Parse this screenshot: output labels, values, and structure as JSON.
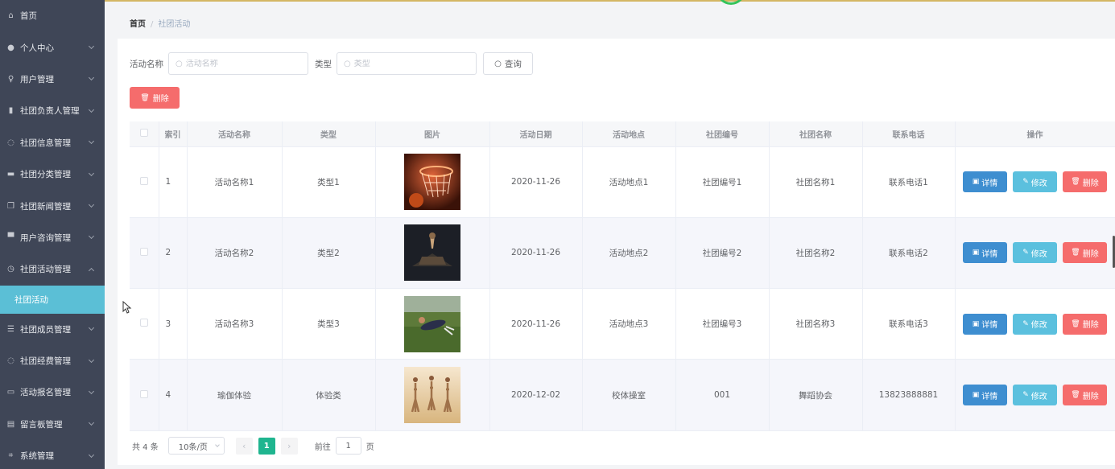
{
  "sidebar": {
    "items": [
      {
        "label": "首页",
        "icon": "home-icon",
        "chevron": false
      },
      {
        "label": "个人中心",
        "icon": "user-icon",
        "chevron": true
      },
      {
        "label": "用户管理",
        "icon": "microphone-icon",
        "chevron": true
      },
      {
        "label": "社团负责人管理",
        "icon": "bar-chart-icon",
        "chevron": true
      },
      {
        "label": "社团信息管理",
        "icon": "globe-icon",
        "chevron": true
      },
      {
        "label": "社团分类管理",
        "icon": "monitor-icon",
        "chevron": true
      },
      {
        "label": "社团新闻管理",
        "icon": "copy-icon",
        "chevron": true
      },
      {
        "label": "用户咨询管理",
        "icon": "message-icon",
        "chevron": true
      },
      {
        "label": "社团活动管理",
        "icon": "clock-icon",
        "chevron": true,
        "expanded": true
      }
    ],
    "active_sub": "社团活动",
    "items_after": [
      {
        "label": "社团成员管理",
        "icon": "list-icon",
        "chevron": true
      },
      {
        "label": "社团经费管理",
        "icon": "globe-icon",
        "chevron": true
      },
      {
        "label": "活动报名管理",
        "icon": "chat-icon",
        "chevron": true
      },
      {
        "label": "留言板管理",
        "icon": "briefcase-icon",
        "chevron": true
      },
      {
        "label": "系统管理",
        "icon": "crop-icon",
        "chevron": true
      }
    ]
  },
  "breadcrumb": {
    "home": "首页",
    "sep": "/",
    "current": "社团活动"
  },
  "filters": {
    "name_label": "活动名称",
    "name_placeholder": "活动名称",
    "type_label": "类型",
    "type_placeholder": "类型",
    "query_label": "查询"
  },
  "delete_button": "删除",
  "table": {
    "headers": [
      "",
      "索引",
      "活动名称",
      "类型",
      "图片",
      "活动日期",
      "活动地点",
      "社团编号",
      "社团名称",
      "联系电话",
      "操作"
    ],
    "rows": [
      {
        "index": "1",
        "name": "活动名称1",
        "type": "类型1",
        "image": "basketball-hoop-image",
        "date": "2020-11-26",
        "place": "活动地点1",
        "club_no": "社团编号1",
        "club_name": "社团名称1",
        "phone": "联系电话1"
      },
      {
        "index": "2",
        "name": "活动名称2",
        "type": "类型2",
        "image": "dark-court-image",
        "date": "2020-11-26",
        "place": "活动地点2",
        "club_no": "社团编号2",
        "club_name": "社团名称2",
        "phone": "联系电话2"
      },
      {
        "index": "3",
        "name": "活动名称3",
        "type": "类型3",
        "image": "football-catch-image",
        "date": "2020-11-26",
        "place": "活动地点3",
        "club_no": "社团编号3",
        "club_name": "社团名称3",
        "phone": "联系电话3"
      },
      {
        "index": "4",
        "name": "瑜伽体验",
        "type": "体验类",
        "image": "yoga-class-image",
        "date": "2020-12-02",
        "place": "校体操室",
        "club_no": "001",
        "club_name": "舞蹈协会",
        "phone": "13823888881"
      }
    ],
    "actions": {
      "detail": "详情",
      "edit": "修改",
      "delete": "删除"
    }
  },
  "pagination": {
    "total": "共 4 条",
    "page_size": "10条/页",
    "current_page": "1",
    "goto_label": "前往",
    "goto_value": "1",
    "page_unit": "页"
  },
  "colors": {
    "sidebar_bg": "#3f4657",
    "active_sub_bg": "#5bbfd6",
    "detail_btn": "#3e8ed0",
    "edit_btn": "#5bc0de",
    "delete_btn": "#f56c6c",
    "page_active": "#1fb58f"
  }
}
